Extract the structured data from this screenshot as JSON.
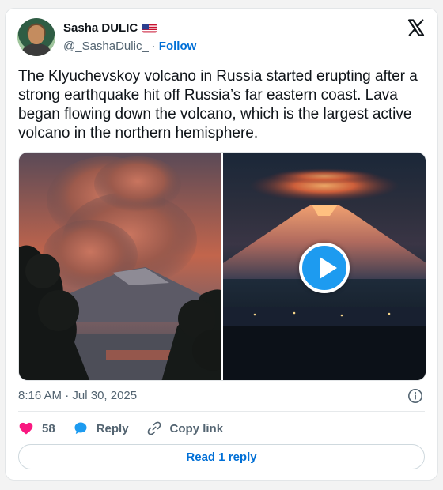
{
  "author": {
    "name": "Sasha DULIC",
    "flag_icon": "us-flag-icon",
    "handle": "@_SashaDulic_",
    "separator": "·",
    "follow_label": "Follow"
  },
  "brand_icon": "x-logo-icon",
  "tweet": {
    "text": "The Klyuchevskoy volcano in Russia started erupting after a strong earthquake hit off Russia’s far eastern coast. Lava began flowing down the volcano, which is the largest active volcano in the northern hemisphere."
  },
  "media": {
    "items": [
      {
        "kind": "photo",
        "subject": "erupting-volcano-ash-plume"
      },
      {
        "kind": "video",
        "subject": "glowing-volcano-at-night",
        "play_icon": "play-icon"
      }
    ]
  },
  "meta": {
    "time": "8:16 AM",
    "separator": "·",
    "date": "Jul 30, 2025",
    "info_icon": "info-icon"
  },
  "actions": {
    "like": {
      "icon": "heart-icon",
      "count": "58"
    },
    "reply": {
      "icon": "reply-bubble-icon",
      "label": "Reply"
    },
    "copy": {
      "icon": "link-icon",
      "label": "Copy link"
    }
  },
  "read_reply_label": "Read 1 reply",
  "colors": {
    "accent": "#006fd6",
    "like": "#f91880",
    "reply": "#1d9bf0",
    "text": "#0f1419",
    "muted": "#536471"
  }
}
